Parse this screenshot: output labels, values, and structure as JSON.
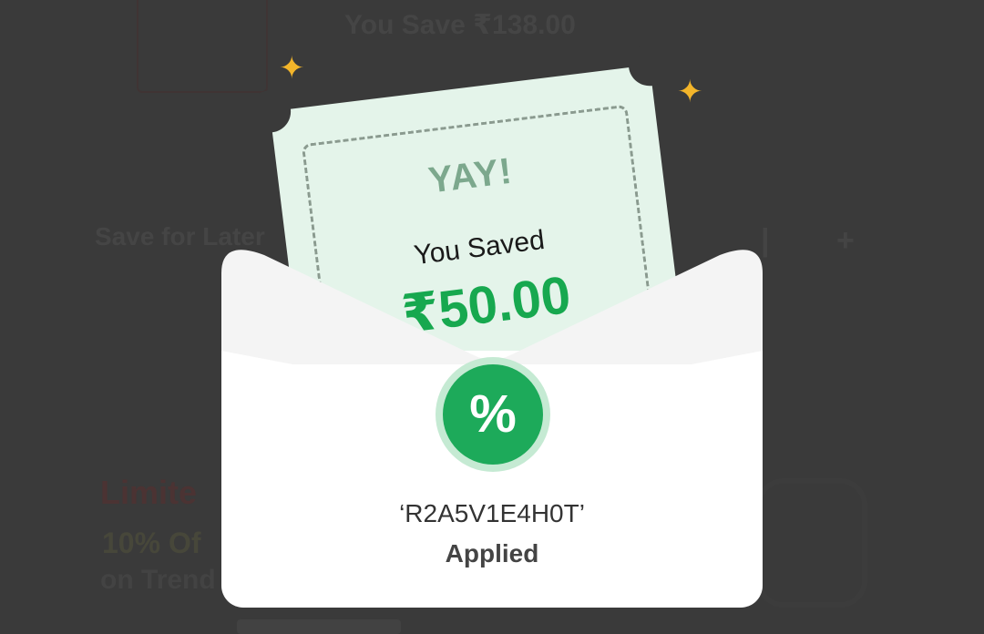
{
  "background": {
    "you_save": "You Save ₹138.00",
    "save_for_later": "Save for Later",
    "limited": "Limite",
    "off": "10% Of",
    "trend": "on Trend"
  },
  "coupon": {
    "headline": "YAY!",
    "saved_label": "You Saved",
    "saved_amount": "₹50.00",
    "badge_symbol": "%",
    "code": "‘R2A5V1E4H0T’",
    "status": "Applied"
  },
  "colors": {
    "overlay": "#3a3a3a",
    "ticket": "#e4f4ea",
    "accent_green": "#17a84f",
    "sparkle": "#f3b52a"
  }
}
